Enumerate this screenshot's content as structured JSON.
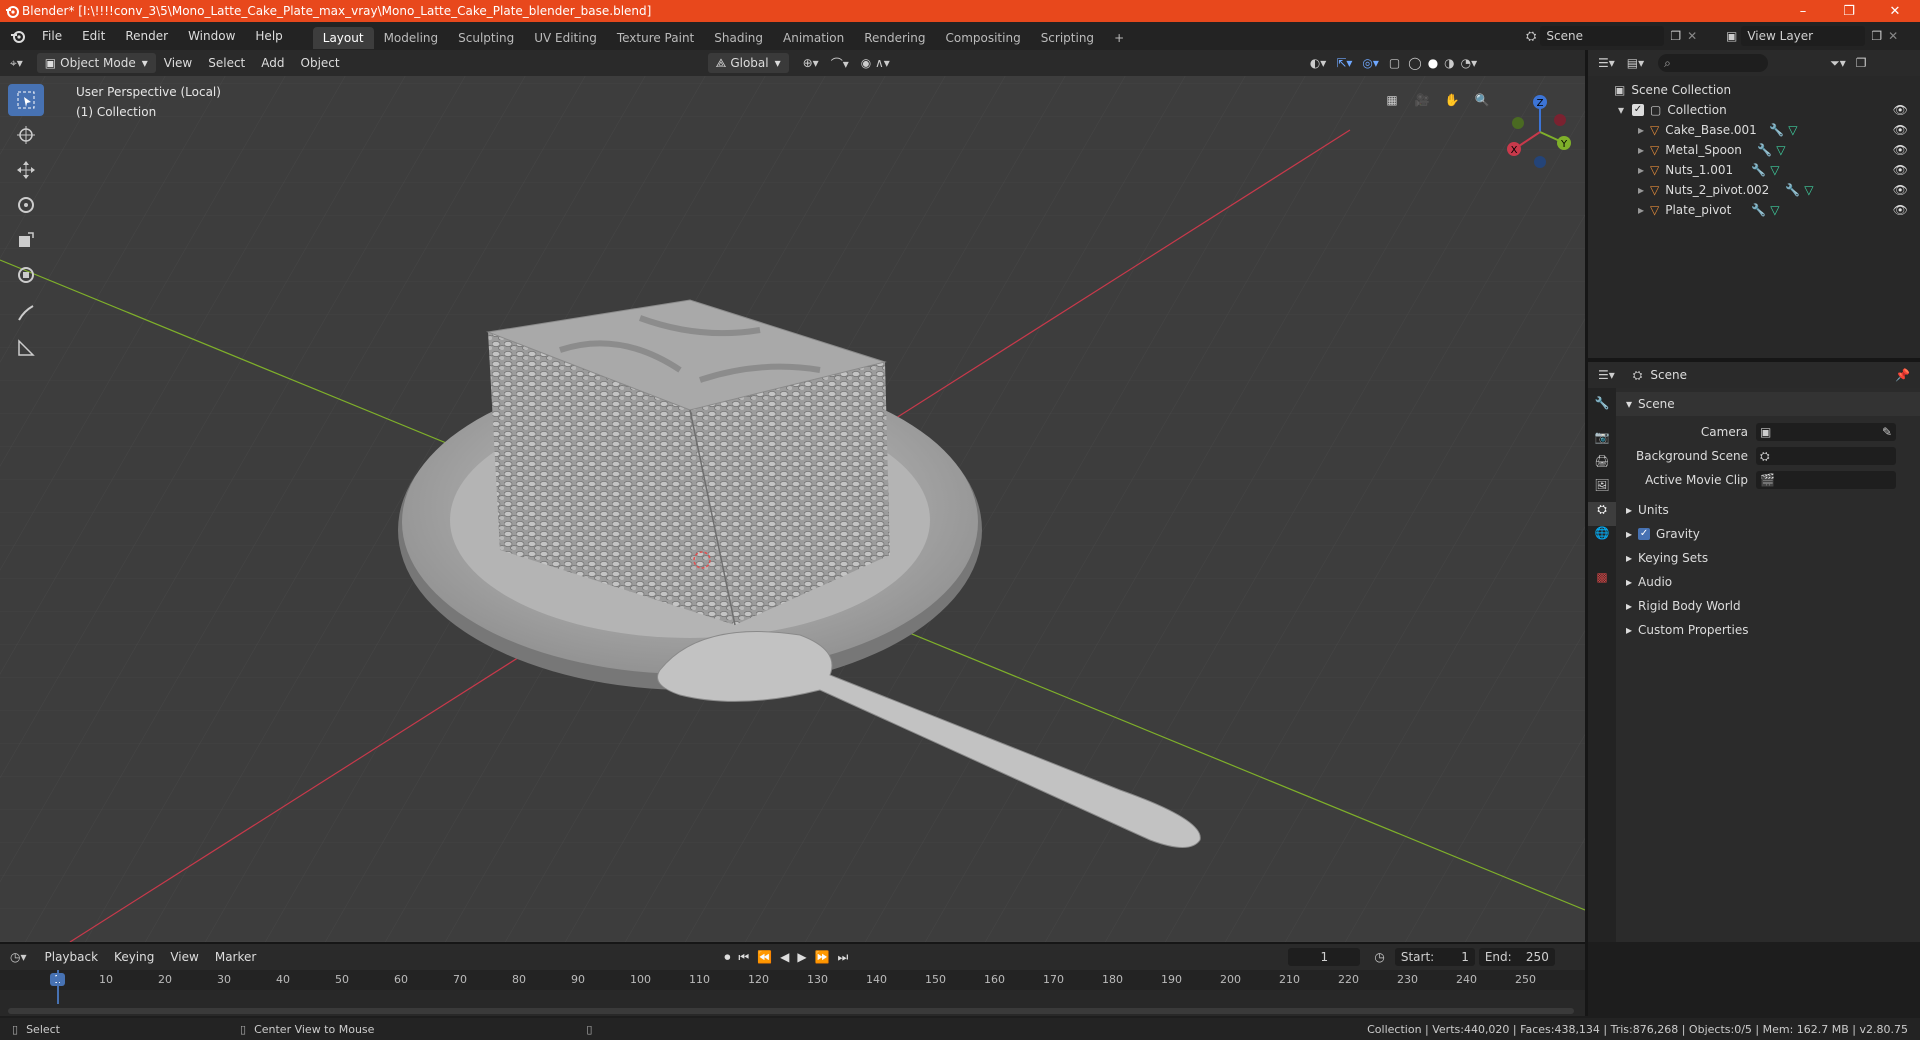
{
  "window": {
    "title": "Blender* [I:\\!!!!conv_3\\5\\Mono_Latte_Cake_Plate_max_vray\\Mono_Latte_Cake_Plate_blender_base.blend]",
    "minimize": "–",
    "maximize": "❐",
    "close": "✕"
  },
  "menubar": {
    "items": [
      "File",
      "Edit",
      "Render",
      "Window",
      "Help"
    ],
    "workspaces": [
      "Layout",
      "Modeling",
      "Sculpting",
      "UV Editing",
      "Texture Paint",
      "Shading",
      "Animation",
      "Rendering",
      "Compositing",
      "Scripting"
    ],
    "active_workspace": "Layout",
    "add_workspace": "+",
    "scene": "Scene",
    "view_layer": "View Layer"
  },
  "viewport_header": {
    "mode": "Object Mode",
    "menus": [
      "View",
      "Select",
      "Add",
      "Object"
    ],
    "orientation": "Global"
  },
  "viewport": {
    "perspective": "User Perspective (Local)",
    "collection": "(1) Collection",
    "gizmo": {
      "x": "X",
      "y": "Y",
      "z": "Z"
    }
  },
  "outliner": {
    "root": "Scene Collection",
    "collection": "Collection",
    "objects": [
      "Cake_Base.001",
      "Metal_Spoon",
      "Nuts_1.001",
      "Nuts_2_pivot.002",
      "Plate_pivot"
    ]
  },
  "properties": {
    "context": "Scene",
    "section": "Scene",
    "fields": [
      {
        "label": "Camera",
        "value": ""
      },
      {
        "label": "Background Scene",
        "value": ""
      },
      {
        "label": "Active Movie Clip",
        "value": ""
      }
    ],
    "panels": [
      "Units",
      "Gravity",
      "Keying Sets",
      "Audio",
      "Rigid Body World",
      "Custom Properties"
    ],
    "gravity_checked": true
  },
  "timeline": {
    "menus": [
      "Playback",
      "Keying",
      "View",
      "Marker"
    ],
    "current_frame": "1",
    "start_label": "Start:",
    "start": "1",
    "end_label": "End:",
    "end": "250",
    "ticks": [
      "1",
      "10",
      "20",
      "30",
      "40",
      "50",
      "60",
      "70",
      "80",
      "90",
      "100",
      "110",
      "120",
      "130",
      "140",
      "150",
      "160",
      "170",
      "180",
      "190",
      "200",
      "210",
      "220",
      "230",
      "240",
      "250"
    ]
  },
  "statusbar": {
    "left": "Select",
    "middle": "Center View to Mouse",
    "right": "Collection | Verts:440,020 | Faces:438,134 | Tris:876,268 | Objects:0/5 | Mem: 162.7 MB | v2.80.75"
  },
  "colors": {
    "titlebar": "#e8481c",
    "accent": "#4772b3",
    "viewport_bg": "#3d3d3d",
    "x_axis": "#c8394b",
    "y_axis": "#7fb02a",
    "object_orange": "#e08a3a"
  }
}
